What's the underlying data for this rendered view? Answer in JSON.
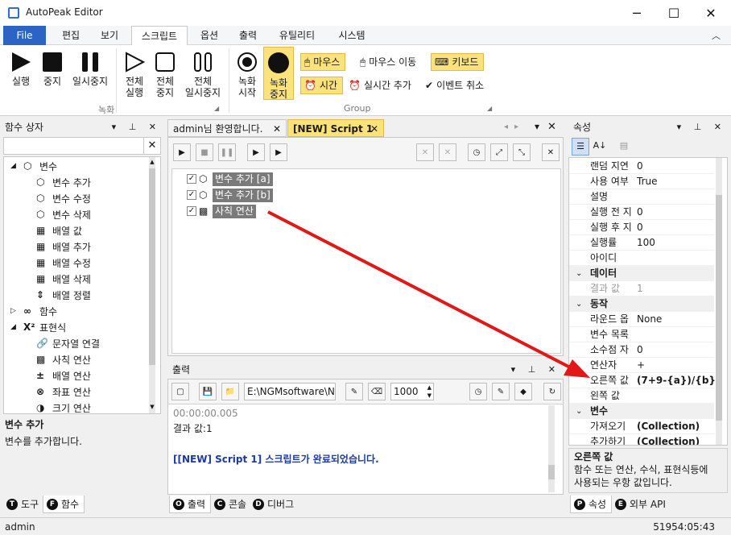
{
  "window": {
    "title": "AutoPeak Editor",
    "minimize": "─",
    "maximize": "☐",
    "close": "✕"
  },
  "menu_tabs": [
    {
      "label": "File"
    },
    {
      "label": "편집"
    },
    {
      "label": "보기"
    },
    {
      "label": "스크립트"
    },
    {
      "label": "옵션"
    },
    {
      "label": "출력"
    },
    {
      "label": "유틸리티"
    },
    {
      "label": "시스템"
    }
  ],
  "ribbon": {
    "run": "실행",
    "stop": "중지",
    "pause": "일시중지",
    "run_all_1": "전체",
    "run_all_2": "실행",
    "stop_all_1": "전체",
    "stop_all_2": "중지",
    "pause_all_1": "전체",
    "pause_all_2": "일시중지",
    "rec_start_1": "녹화",
    "rec_start_2": "시작",
    "rec_stop_1": "녹화",
    "rec_stop_2": "중지",
    "mouse": "마우스",
    "mouse_move": "마우스 이동",
    "keyboard": "키보드",
    "time": "시간",
    "realtime_add": "실시간 추가",
    "event_cancel": "이벤트 취소",
    "group_record": "녹화",
    "group_group": "Group"
  },
  "func_panel": {
    "title": "함수 상자",
    "search_placeholder": "",
    "items": [
      {
        "label": "변수",
        "level": 0,
        "expanded": true
      },
      {
        "label": "변수 추가",
        "level": 1
      },
      {
        "label": "변수 수정",
        "level": 1
      },
      {
        "label": "변수 삭제",
        "level": 1
      },
      {
        "label": "배열 값",
        "level": 1
      },
      {
        "label": "배열 추가",
        "level": 1
      },
      {
        "label": "배열 수정",
        "level": 1
      },
      {
        "label": "배열 삭제",
        "level": 1
      },
      {
        "label": "배열 정렬",
        "level": 1
      },
      {
        "label": "함수",
        "level": 0,
        "expanded": false
      },
      {
        "label": "표현식",
        "level": 0,
        "expanded": true
      },
      {
        "label": "문자열 연결",
        "level": 1
      },
      {
        "label": "사칙 연산",
        "level": 1
      },
      {
        "label": "배열 연산",
        "level": 1
      },
      {
        "label": "좌표 연산",
        "level": 1
      },
      {
        "label": "크기 연산",
        "level": 1
      }
    ],
    "desc_title": "변수 추가",
    "desc_text": "변수를 추가합니다.",
    "tab_tools": "도구",
    "tab_tools_icon": "T",
    "tab_funcs": "함수",
    "tab_funcs_icon": "F"
  },
  "editor": {
    "tab1": "admin님 환영합니다.",
    "tab2": "[NEW] Script 1",
    "nodes": [
      {
        "label": "변수 추가 [a]"
      },
      {
        "label": "변수 추가 [b]"
      },
      {
        "label": "사칙 연산"
      }
    ]
  },
  "output": {
    "title": "출력",
    "path": "E:\\NGMsoftware\\NG",
    "count": "1000",
    "lines": [
      "00:00:00.005",
      "결과 값:1",
      "",
      "[[NEW] Script 1] 스크립트가 완료되었습니다."
    ],
    "tab_output": "출력",
    "tab_output_icon": "O",
    "tab_console": "콘솔",
    "tab_console_icon": "C",
    "tab_debug": "디버그",
    "tab_debug_icon": "D"
  },
  "props": {
    "title": "속성",
    "rows": [
      {
        "type": "row",
        "k": "랜덤 지연",
        "v": "0"
      },
      {
        "type": "row",
        "k": "사용 여부",
        "v": "True"
      },
      {
        "type": "row",
        "k": "설명",
        "v": ""
      },
      {
        "type": "row",
        "k": "실행 전 지",
        "v": "0"
      },
      {
        "type": "row",
        "k": "실행 후 지",
        "v": "0"
      },
      {
        "type": "row",
        "k": "실행률",
        "v": "100"
      },
      {
        "type": "row",
        "k": "아이디",
        "v": ""
      },
      {
        "type": "cat",
        "k": "데이터"
      },
      {
        "type": "row",
        "k": "결과 값",
        "v": "1",
        "disabled": true
      },
      {
        "type": "cat",
        "k": "동작"
      },
      {
        "type": "row",
        "k": "라운드 옵",
        "v": "None"
      },
      {
        "type": "row",
        "k": "변수 목록",
        "v": ""
      },
      {
        "type": "row",
        "k": "소수점 자",
        "v": "0"
      },
      {
        "type": "row",
        "k": "연산자",
        "v": "+"
      },
      {
        "type": "row",
        "k": "오른쪽 값",
        "v": "(7+9-{a})/{b}",
        "bold": true
      },
      {
        "type": "row",
        "k": "왼쪽 값",
        "v": ""
      },
      {
        "type": "cat",
        "k": "변수"
      },
      {
        "type": "row",
        "k": "가져오기",
        "v": "(Collection)",
        "bold": true
      },
      {
        "type": "row",
        "k": "추가하기",
        "v": "(Collection)",
        "bold": true
      }
    ],
    "desc_title": "오른쪽 값",
    "desc_text_1": "함수 또는 연산, 수식, 표현식등에",
    "desc_text_2": "사용되는 우항 값입니다.",
    "tab_props": "속성",
    "tab_props_icon": "P",
    "tab_api": "외부 API",
    "tab_api_icon": "E"
  },
  "status": {
    "user": "admin",
    "clock": "51954:05:43"
  },
  "colors": {
    "accent": "#2b64c4",
    "highlight": "#fbe27b",
    "arrow": "#e01818",
    "node": "#7a7a7a"
  }
}
